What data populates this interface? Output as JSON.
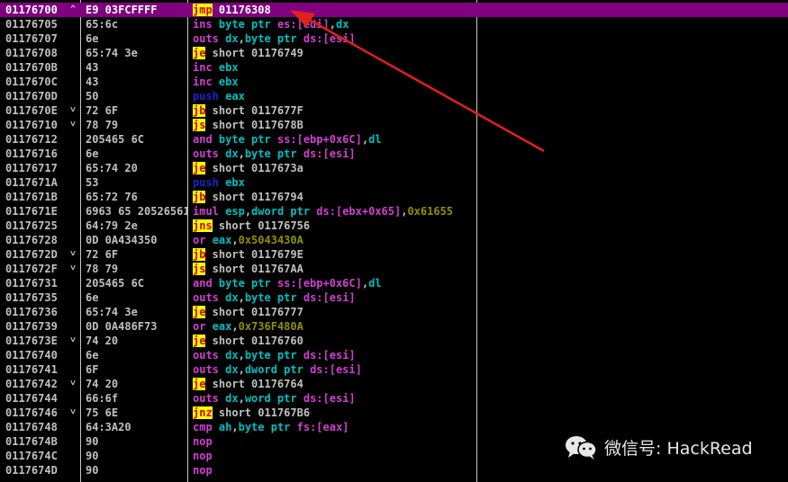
{
  "colors": {
    "background": "#000000",
    "selected_row": "#800080",
    "jump_mnemonic_bg": "#ffff00",
    "jump_mnemonic_fg": "#d00000",
    "purple_mnemonic": "#d040d0",
    "register": "#00c0c0",
    "immediate": "#909000",
    "push_mnemonic": "#2020d0",
    "arrow": "#e02020"
  },
  "rows": [
    {
      "addr": "01176700",
      "mark": "^",
      "hex": "E9 03FCFFFF",
      "selected": true,
      "asm": [
        {
          "t": "jmp",
          "c": "jump"
        },
        {
          "t": " 01176308",
          "c": "op"
        }
      ]
    },
    {
      "addr": "01176705",
      "mark": "",
      "hex": "65:6c",
      "asm": [
        {
          "t": "ins ",
          "c": "purple"
        },
        {
          "t": "byte ptr ",
          "c": "size"
        },
        {
          "t": "es:[edi]",
          "c": "purple"
        },
        {
          "t": ",",
          "c": "op"
        },
        {
          "t": "dx",
          "c": "reg"
        }
      ]
    },
    {
      "addr": "01176707",
      "mark": "",
      "hex": "6e",
      "asm": [
        {
          "t": "outs ",
          "c": "purple"
        },
        {
          "t": "dx",
          "c": "reg"
        },
        {
          "t": ",",
          "c": "op"
        },
        {
          "t": "byte ptr ",
          "c": "size"
        },
        {
          "t": "ds:[esi]",
          "c": "purple"
        }
      ]
    },
    {
      "addr": "01176708",
      "mark": "",
      "hex": "65:74 3e",
      "asm": [
        {
          "t": "je",
          "c": "jump"
        },
        {
          "t": " short 01176749",
          "c": "op"
        }
      ]
    },
    {
      "addr": "0117670B",
      "mark": "",
      "hex": "43",
      "asm": [
        {
          "t": "inc ",
          "c": "purple"
        },
        {
          "t": "ebx",
          "c": "reg"
        }
      ]
    },
    {
      "addr": "0117670C",
      "mark": "",
      "hex": "43",
      "asm": [
        {
          "t": "inc ",
          "c": "purple"
        },
        {
          "t": "ebx",
          "c": "reg"
        }
      ]
    },
    {
      "addr": "0117670D",
      "mark": "",
      "hex": "50",
      "asm": [
        {
          "t": "push ",
          "c": "push"
        },
        {
          "t": "eax",
          "c": "reg"
        }
      ]
    },
    {
      "addr": "0117670E",
      "mark": "˅",
      "hex": "72 6F",
      "asm": [
        {
          "t": "jb",
          "c": "jump"
        },
        {
          "t": " short 0117677F",
          "c": "op"
        }
      ]
    },
    {
      "addr": "01176710",
      "mark": "˅",
      "hex": "78 79",
      "asm": [
        {
          "t": "js",
          "c": "jump"
        },
        {
          "t": " short 0117678B",
          "c": "op"
        }
      ]
    },
    {
      "addr": "01176712",
      "mark": "",
      "hex": "205465 6C",
      "asm": [
        {
          "t": "and ",
          "c": "purple"
        },
        {
          "t": "byte ptr ",
          "c": "size"
        },
        {
          "t": "ss:[ebp+0x6C]",
          "c": "purple"
        },
        {
          "t": ",",
          "c": "op"
        },
        {
          "t": "dl",
          "c": "reg"
        }
      ]
    },
    {
      "addr": "01176716",
      "mark": "",
      "hex": "6e",
      "asm": [
        {
          "t": "outs ",
          "c": "purple"
        },
        {
          "t": "dx",
          "c": "reg"
        },
        {
          "t": ",",
          "c": "op"
        },
        {
          "t": "byte ptr ",
          "c": "size"
        },
        {
          "t": "ds:[esi]",
          "c": "purple"
        }
      ]
    },
    {
      "addr": "01176717",
      "mark": "",
      "hex": "65:74 20",
      "asm": [
        {
          "t": "je",
          "c": "jump"
        },
        {
          "t": " short 0117673a",
          "c": "op"
        }
      ]
    },
    {
      "addr": "0117671A",
      "mark": "",
      "hex": "53",
      "asm": [
        {
          "t": "push ",
          "c": "push"
        },
        {
          "t": "ebx",
          "c": "reg"
        }
      ]
    },
    {
      "addr": "0117671B",
      "mark": "",
      "hex": "65:72 76",
      "asm": [
        {
          "t": "jb",
          "c": "jump"
        },
        {
          "t": " short 01176794",
          "c": "op"
        }
      ]
    },
    {
      "addr": "0117671E",
      "mark": "",
      "hex": "6963 65 20526561",
      "asm": [
        {
          "t": "imul ",
          "c": "purple"
        },
        {
          "t": "esp",
          "c": "reg"
        },
        {
          "t": ",",
          "c": "op"
        },
        {
          "t": "dword ptr ",
          "c": "size"
        },
        {
          "t": "ds:[ebx+0x65]",
          "c": "purple"
        },
        {
          "t": ",",
          "c": "op"
        },
        {
          "t": "0x61655",
          "c": "imm"
        }
      ]
    },
    {
      "addr": "01176725",
      "mark": "",
      "hex": "64:79 2e",
      "asm": [
        {
          "t": "jns",
          "c": "jump"
        },
        {
          "t": " short 01176756",
          "c": "op"
        }
      ]
    },
    {
      "addr": "01176728",
      "mark": "",
      "hex": "0D 0A434350",
      "asm": [
        {
          "t": "or ",
          "c": "purple"
        },
        {
          "t": "eax",
          "c": "reg"
        },
        {
          "t": ",",
          "c": "op"
        },
        {
          "t": "0x5043430A",
          "c": "imm"
        }
      ]
    },
    {
      "addr": "0117672D",
      "mark": "˅",
      "hex": "72 6F",
      "asm": [
        {
          "t": "jb",
          "c": "jump"
        },
        {
          "t": " short 0117679E",
          "c": "op"
        }
      ]
    },
    {
      "addr": "0117672F",
      "mark": "˅",
      "hex": "78 79",
      "asm": [
        {
          "t": "js",
          "c": "jump"
        },
        {
          "t": " short 011767AA",
          "c": "op"
        }
      ]
    },
    {
      "addr": "01176731",
      "mark": "",
      "hex": "205465 6C",
      "asm": [
        {
          "t": "and ",
          "c": "purple"
        },
        {
          "t": "byte ptr ",
          "c": "size"
        },
        {
          "t": "ss:[ebp+0x6C]",
          "c": "purple"
        },
        {
          "t": ",",
          "c": "op"
        },
        {
          "t": "dl",
          "c": "reg"
        }
      ]
    },
    {
      "addr": "01176735",
      "mark": "",
      "hex": "6e",
      "asm": [
        {
          "t": "outs ",
          "c": "purple"
        },
        {
          "t": "dx",
          "c": "reg"
        },
        {
          "t": ",",
          "c": "op"
        },
        {
          "t": "byte ptr ",
          "c": "size"
        },
        {
          "t": "ds:[esi]",
          "c": "purple"
        }
      ]
    },
    {
      "addr": "01176736",
      "mark": "",
      "hex": "65:74 3e",
      "asm": [
        {
          "t": "je",
          "c": "jump"
        },
        {
          "t": " short 01176777",
          "c": "op"
        }
      ]
    },
    {
      "addr": "01176739",
      "mark": "",
      "hex": "0D 0A486F73",
      "asm": [
        {
          "t": "or ",
          "c": "purple"
        },
        {
          "t": "eax",
          "c": "reg"
        },
        {
          "t": ",",
          "c": "op"
        },
        {
          "t": "0x736F480A",
          "c": "imm"
        }
      ]
    },
    {
      "addr": "0117673E",
      "mark": "˅",
      "hex": "74 20",
      "asm": [
        {
          "t": "je",
          "c": "jump"
        },
        {
          "t": " short 01176760",
          "c": "op"
        }
      ]
    },
    {
      "addr": "01176740",
      "mark": "",
      "hex": "6e",
      "asm": [
        {
          "t": "outs ",
          "c": "purple"
        },
        {
          "t": "dx",
          "c": "reg"
        },
        {
          "t": ",",
          "c": "op"
        },
        {
          "t": "byte ptr ",
          "c": "size"
        },
        {
          "t": "ds:[esi]",
          "c": "purple"
        }
      ]
    },
    {
      "addr": "01176741",
      "mark": "",
      "hex": "6F",
      "asm": [
        {
          "t": "outs ",
          "c": "purple"
        },
        {
          "t": "dx",
          "c": "reg"
        },
        {
          "t": ",",
          "c": "op"
        },
        {
          "t": "dword ptr ",
          "c": "size"
        },
        {
          "t": "ds:[esi]",
          "c": "purple"
        }
      ]
    },
    {
      "addr": "01176742",
      "mark": "˅",
      "hex": "74 20",
      "asm": [
        {
          "t": "je",
          "c": "jump"
        },
        {
          "t": " short 01176764",
          "c": "op"
        }
      ]
    },
    {
      "addr": "01176744",
      "mark": "",
      "hex": "66:6f",
      "asm": [
        {
          "t": "outs ",
          "c": "purple"
        },
        {
          "t": "dx",
          "c": "reg"
        },
        {
          "t": ",",
          "c": "op"
        },
        {
          "t": "word ptr ",
          "c": "size"
        },
        {
          "t": "ds:[esi]",
          "c": "purple"
        }
      ]
    },
    {
      "addr": "01176746",
      "mark": "˅",
      "hex": "75 6E",
      "asm": [
        {
          "t": "jnz",
          "c": "jump"
        },
        {
          "t": " short 011767B6",
          "c": "op"
        }
      ]
    },
    {
      "addr": "01176748",
      "mark": "",
      "hex": "64:3A20",
      "asm": [
        {
          "t": "cmp ",
          "c": "purple"
        },
        {
          "t": "ah",
          "c": "reg"
        },
        {
          "t": ",",
          "c": "op"
        },
        {
          "t": "byte ptr ",
          "c": "size"
        },
        {
          "t": "fs:[eax]",
          "c": "purple"
        }
      ]
    },
    {
      "addr": "0117674B",
      "mark": "",
      "hex": "90",
      "asm": [
        {
          "t": "nop",
          "c": "purple"
        }
      ]
    },
    {
      "addr": "0117674C",
      "mark": "",
      "hex": "90",
      "asm": [
        {
          "t": "nop",
          "c": "purple"
        }
      ]
    },
    {
      "addr": "0117674D",
      "mark": "",
      "hex": "90",
      "asm": [
        {
          "t": "nop",
          "c": "purple"
        }
      ]
    }
  ],
  "watermark": {
    "icon": "wechat-icon",
    "text": "微信号: HackRead"
  }
}
